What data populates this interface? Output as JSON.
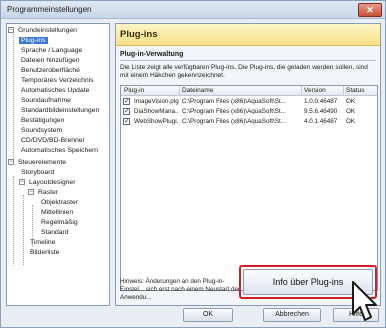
{
  "window": {
    "title": "Programmeinstellungen",
    "close_glyph": "✕"
  },
  "tree": {
    "items": [
      {
        "label": "Grundeinstellungen",
        "expander": "−"
      },
      {
        "label": "Plug-ins"
      },
      {
        "label": "Sprache / Language"
      },
      {
        "label": "Dateien hinzufügen"
      },
      {
        "label": "Benutzeroberfläche"
      },
      {
        "label": "Temporäres Verzeichnis"
      },
      {
        "label": "Automatisches Update"
      },
      {
        "label": "Soundaufnahme"
      },
      {
        "label": "Standardbildeinstellungen"
      },
      {
        "label": "Bestätigungen"
      },
      {
        "label": "Soundsystem"
      },
      {
        "label": "CD/DVD/BD-Brenner"
      },
      {
        "label": "Automatisches Speichern"
      },
      {
        "label": "Steuerelemente",
        "expander": "−"
      },
      {
        "label": "Storyboard"
      },
      {
        "label": "Layoutdesigner",
        "expander": "−"
      },
      {
        "label": "Raster",
        "expander": "−"
      },
      {
        "label": "Objektraster"
      },
      {
        "label": "Mittellinien"
      },
      {
        "label": "Regelmäßig"
      },
      {
        "label": "Standard"
      },
      {
        "label": "Timeline"
      },
      {
        "label": "Bilderliste"
      }
    ]
  },
  "panel": {
    "header": "Plug-ins",
    "section": "Plug-in-Verwaltung",
    "description": "Die Liste zeigt alle verfügbaren Plug-ins. Die Plug-ins, die geladen werden sollen, sind mit einem Häkchen gekennzeichnet.",
    "columns": [
      "Plug-in",
      "Dateiname",
      "Version",
      "Status"
    ],
    "rows": [
      {
        "check": "✓",
        "name": "ImageVision.plg",
        "file": "C:\\Program Files (x86)\\AquaSoft\\St...",
        "version": "1.0.0.46487",
        "status": "OK"
      },
      {
        "check": "✓",
        "name": "DiaShowMana...",
        "file": "C:\\Program Files (x86)\\AquaSoft\\St...",
        "version": "9.5.6.46490",
        "status": "OK"
      },
      {
        "check": "✓",
        "name": "WebShowPlugi...",
        "file": "C:\\Program Files (x86)\\AquaSoft\\St...",
        "version": "4.0.1.46487",
        "status": "OK"
      }
    ],
    "hint": "Hinweis: Änderungen an den Plug-in-Einstel... sich erst nach einem Neustart der Anwendu...",
    "info_button": "Info über Plug-ins"
  },
  "footer": {
    "ok": "OK",
    "cancel": "Abbrechen",
    "help": "Hilfe"
  },
  "colors": {
    "selection": "#3a79d3",
    "highlight_frame": "#d01f25",
    "header_bg": "#f7df86"
  }
}
